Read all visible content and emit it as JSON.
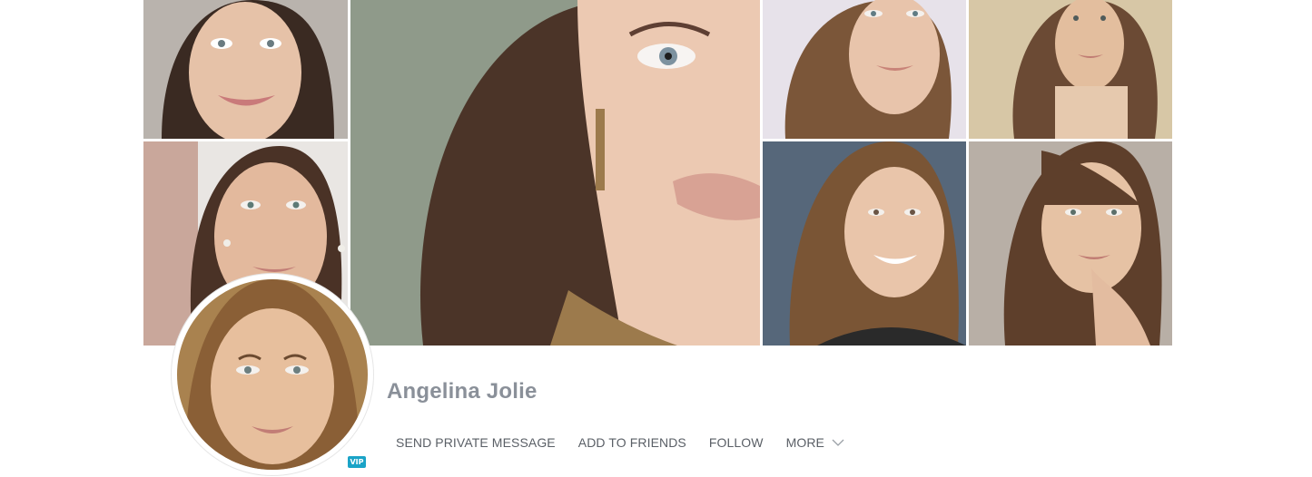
{
  "profile": {
    "name": "Angelina Jolie",
    "badge": "VIP"
  },
  "actions": {
    "send_message": "SEND PRIVATE MESSAGE",
    "add_friends": "ADD TO FRIENDS",
    "follow": "FOLLOW",
    "more": "MORE"
  },
  "colors": {
    "name_text": "#8a9099",
    "action_text": "#5a5f66",
    "badge_bg": "#1aa3c7"
  },
  "icons": {
    "more": "chevron-down-icon"
  }
}
